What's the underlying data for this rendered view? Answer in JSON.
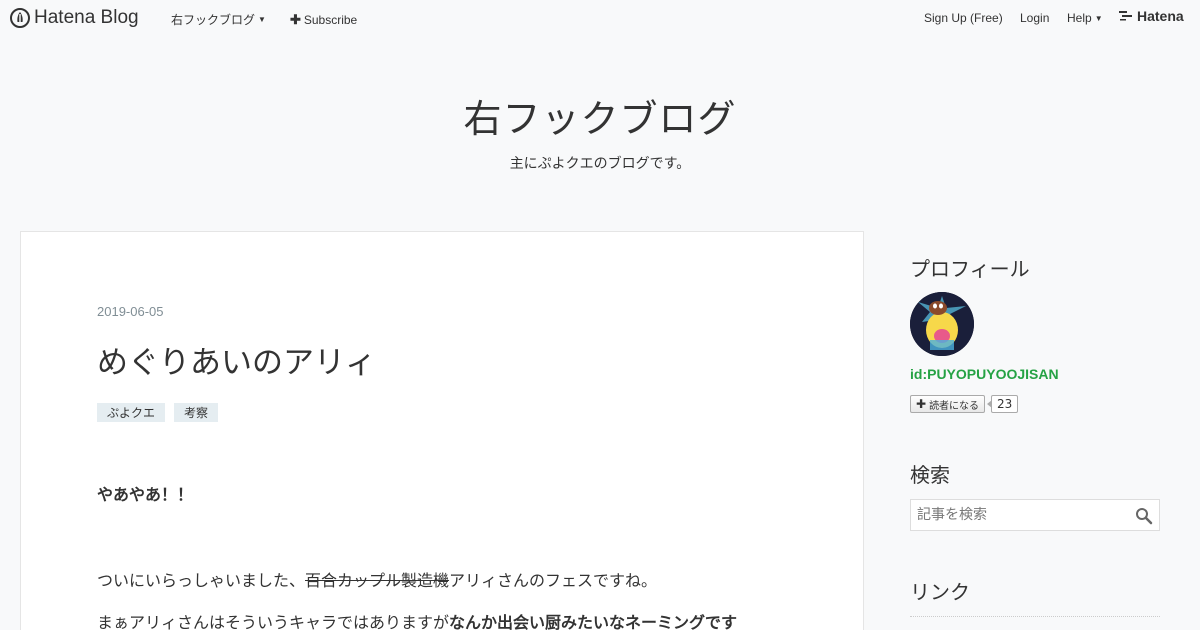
{
  "topbar": {
    "logo_text": "Hatena Blog",
    "blog_menu": "右フックブログ",
    "subscribe": "Subscribe",
    "signup": "Sign Up (Free)",
    "login": "Login",
    "help": "Help",
    "brand": "Hatena"
  },
  "header": {
    "title": "右フックブログ",
    "description": "主にぷよクエのブログです。"
  },
  "entry": {
    "date": "2019-06-05",
    "title": "めぐりあいのアリィ",
    "tags": [
      "ぷよクエ",
      "考察"
    ],
    "p1": "やあやあ！！",
    "p2_before": "ついにいらっしゃいました、",
    "p2_strike": "百合カップル製造機",
    "p2_after": "アリィさんのフェスですね。",
    "p3_normal": "まぁアリィさんはそういうキャラではありますが",
    "p3_bold": "なんか出会い厨みたいなネーミングです"
  },
  "sidebar": {
    "profile_heading": "プロフィール",
    "profile_id": "id:PUYOPUYOOJISAN",
    "reader_button": "読者になる",
    "reader_count": "23",
    "search_heading": "検索",
    "search_placeholder": "記事を検索",
    "links_heading": "リンク"
  },
  "colors": {
    "background": "#f8f9fa",
    "card": "#ffffff",
    "tag_bg": "#e5edf1",
    "profile_id": "#25a244",
    "date": "#808e95"
  },
  "icons": [
    "hatena-blog-logo-icon",
    "caret-down-icon",
    "plus-icon",
    "hatena-lines-icon",
    "search-icon"
  ]
}
